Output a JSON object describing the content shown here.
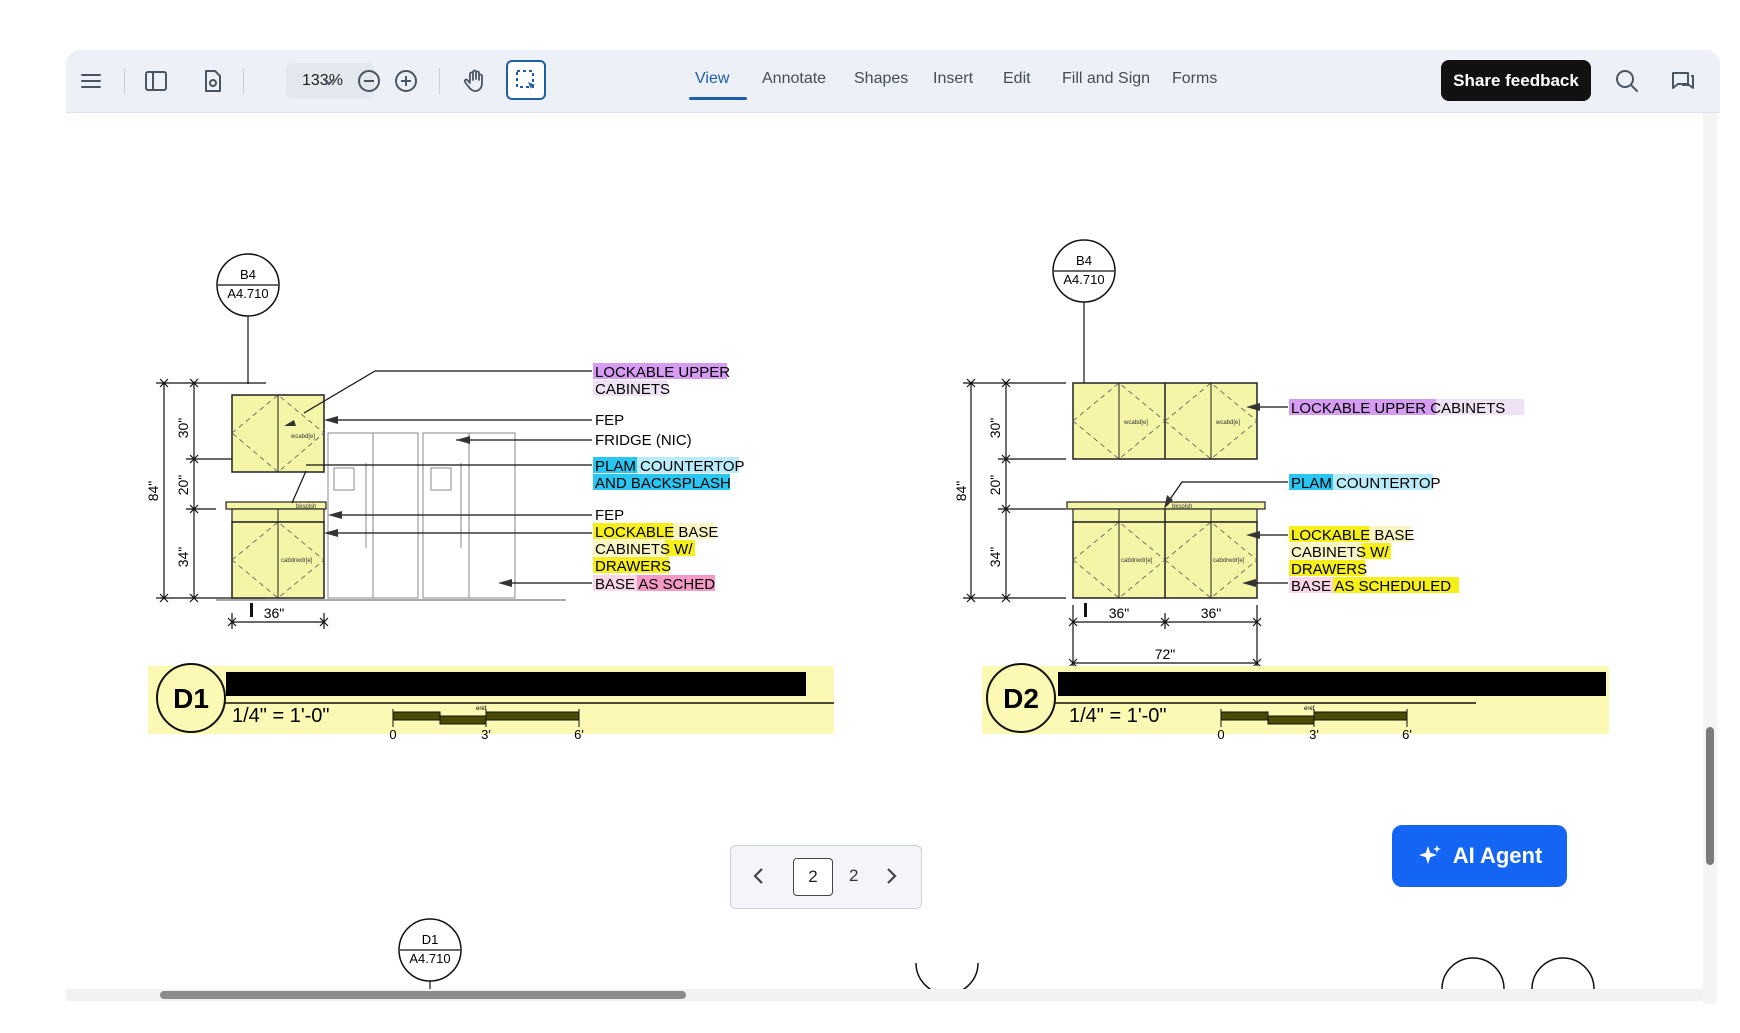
{
  "toolbar": {
    "zoom_value": "133%",
    "tabs": [
      {
        "label": "View",
        "active": true
      },
      {
        "label": "Annotate"
      },
      {
        "label": "Shapes"
      },
      {
        "label": "Insert"
      },
      {
        "label": "Edit"
      },
      {
        "label": "Fill and Sign"
      },
      {
        "label": "Forms"
      }
    ],
    "share_feedback": "Share feedback",
    "icons": [
      "menu-icon",
      "sidebar-toggle-icon",
      "page-settings-icon",
      "chevron-down-icon",
      "zoom-out-icon",
      "zoom-in-icon",
      "hand-tool-icon",
      "select-tool-icon",
      "search-icon",
      "comments-icon"
    ]
  },
  "document": {
    "left_elevation": {
      "tag_top": "B4",
      "tag_bottom": "A4.710",
      "dims": {
        "upper": "30\"",
        "gap": "20\"",
        "base": "34\"",
        "total": "84\"",
        "width": "36\""
      },
      "cab_labels": {
        "upper": "wcabd[e]",
        "backsplash": "bksplsh",
        "base": "cabdrwdr[e]"
      },
      "callouts": [
        {
          "hl": "LOCKABLE UPPER",
          "rest": ""
        },
        {
          "hl": "",
          "rest": "CABINETS"
        },
        {
          "hl": "",
          "rest": "FEP"
        },
        {
          "hl": "",
          "rest": "FRIDGE (NIC)"
        },
        {
          "hl": "PLAM",
          "rest": " COUNTERTOP"
        },
        {
          "hl": "AND BACKSPLASH",
          "rest": ""
        },
        {
          "hl": "",
          "rest": "FEP"
        },
        {
          "hl": "LOCKABLE",
          "rest": " BASE"
        },
        {
          "hl": "CABINETS",
          "rest": " W/"
        },
        {
          "hl": "DRAWERS",
          "rest": ""
        },
        {
          "hl": "BASE",
          "rest": " AS SCHED"
        }
      ],
      "title_id": "D1",
      "scale": "1/4\" = 1'-0\"",
      "bar_labels": [
        "0",
        "3'",
        "6'"
      ],
      "bar_tag": "eref"
    },
    "right_elevation": {
      "tag_top": "B4",
      "tag_bottom": "A4.710",
      "dims": {
        "upper": "30\"",
        "gap": "20\"",
        "base": "34\"",
        "total": "84\"",
        "width_a": "36\"",
        "width_b": "36\"",
        "width_total": "72\""
      },
      "cab_labels": {
        "upper_a": "wcabd[e]",
        "upper_b": "wcabd[e]",
        "backsplash": "bksplsh",
        "base_a": "cabdrwdr[e]",
        "base_b": "cabdrwdr[e]"
      },
      "callouts": [
        {
          "hl": "LOCKABLE UPPER",
          "rest": " CABINETS"
        },
        {
          "hl": "PLAM",
          "rest": " COUNTERTOP"
        },
        {
          "hl": "LOCKABLE",
          "rest": " BASE"
        },
        {
          "hl": "CABINETS",
          "rest": " W/"
        },
        {
          "hl": "DRAWERS",
          "rest": ""
        },
        {
          "hl": "BASE",
          "rest": " AS SCHEDULED"
        }
      ],
      "title_id": "D2",
      "scale": "1/4\" = 1'-0\"",
      "bar_labels": [
        "0",
        "3'",
        "6'"
      ],
      "bar_tag": "eref"
    },
    "bottom_tag": {
      "top": "D1",
      "bottom": "A4.710"
    }
  },
  "pager": {
    "current": "2",
    "total": "2"
  },
  "ai_agent": "AI Agent",
  "colors": {
    "accent": "#1d5fa6",
    "purple_highlight": "#d59cf2",
    "cyan_highlight": "#29c6f2",
    "yellow_highlight": "#f6ef1a",
    "pink_highlight": "#f59ac6",
    "cabinet_fill": "#f5f5a8",
    "agent_button": "#1565f4"
  }
}
